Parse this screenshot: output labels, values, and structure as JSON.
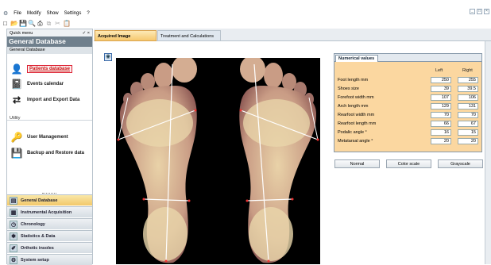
{
  "menu": [
    "File",
    "Modify",
    "Show",
    "Settings",
    "?"
  ],
  "window_buttons": [
    "_",
    "□",
    "×"
  ],
  "sidebar": {
    "quick_menu": "Quick menu",
    "pin": "✓ ×",
    "title": "General Database",
    "subtitle": "General Database",
    "items": [
      {
        "label": "Patients database",
        "icon": "patient-icon",
        "glyph": "👤"
      },
      {
        "label": "Events calendar",
        "icon": "calendar-icon",
        "glyph": "📓"
      },
      {
        "label": "Import and Export Data",
        "icon": "import-export-icon",
        "glyph": "⇄"
      }
    ],
    "utility_label": "Utility",
    "utility_items": [
      {
        "label": "User Management",
        "icon": "users-icon",
        "glyph": "🔑"
      },
      {
        "label": "Backup and Restore data",
        "icon": "backup-icon",
        "glyph": "💾"
      }
    ],
    "nav": [
      {
        "label": "General Database",
        "glyph": "▤"
      },
      {
        "label": "Instrumental Acquisition",
        "glyph": "▦"
      },
      {
        "label": "Chronology",
        "glyph": "◷"
      },
      {
        "label": "Statistics & Data",
        "glyph": "✱"
      },
      {
        "label": "Orthotic insoles",
        "glyph": "✐"
      },
      {
        "label": "System setup",
        "glyph": "⚙"
      }
    ]
  },
  "tabs": [
    "Acquired Image",
    "Treatment and Calculations"
  ],
  "panel": {
    "tab": "Numerical values",
    "col_left": "Left",
    "col_right": "Right",
    "rows": [
      {
        "label": "Foot length mm",
        "left": "250",
        "right": "255"
      },
      {
        "label": "Shoes size",
        "left": "39",
        "right": "39.5"
      },
      {
        "label": "Forefoot width mm",
        "left": "107",
        "right": "106"
      },
      {
        "label": "Arch length mm",
        "left": "129",
        "right": "131"
      },
      {
        "label": "Rearfoot width mm",
        "left": "70",
        "right": "70"
      },
      {
        "label": "Rearfoot length mm",
        "left": "66",
        "right": "67"
      },
      {
        "label": "Podalic angle °",
        "left": "16",
        "right": "15"
      },
      {
        "label": "Metatarsal angle °",
        "left": "20",
        "right": "20"
      }
    ]
  },
  "modes": [
    "Normal",
    "Color scale",
    "Grayscale"
  ],
  "colors": {
    "accent": "#f6c86e",
    "header": "#6f7f8c",
    "panel": "#fbd7a0"
  }
}
